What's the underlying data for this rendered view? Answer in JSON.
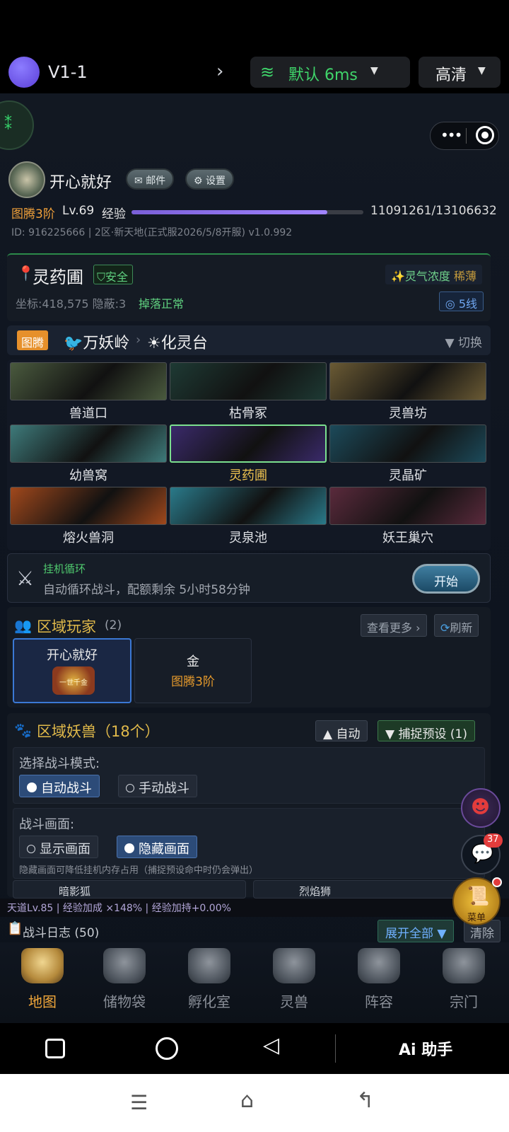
{
  "topbar": {
    "app_title": "V1-1",
    "network_label": "默认 6ms",
    "quality_label": "高清"
  },
  "profile": {
    "name": "开心就好",
    "mail_label": "邮件",
    "settings_label": "设置",
    "rank": "图腾3阶",
    "level": "Lv.69",
    "exp_label": "经验",
    "exp_value": "11091261/13106632",
    "exp_fraction": 0.846,
    "id_line": "ID: 916225666 | 2区·新天地(正式服2026/5/8开服) v1.0.992"
  },
  "location": {
    "name": "灵药圃",
    "safe_label": "安全",
    "aura_label": "灵气浓度",
    "aura_value": "稀薄",
    "coord": "坐标:418,575",
    "hidden": "隐蔽:3",
    "drop_status": "掉落正常",
    "line_label": "5线"
  },
  "region": {
    "tag": "图腾",
    "area": "万妖岭",
    "zone": "化灵台",
    "switch_label": "▼ 切换"
  },
  "maps": [
    {
      "name": "兽道口",
      "color": "#4a5a3e"
    },
    {
      "name": "枯骨冢",
      "color": "#1e3a34"
    },
    {
      "name": "灵兽坊",
      "color": "#6a5a34"
    },
    {
      "name": "幼兽窝",
      "color": "#3e7a7a"
    },
    {
      "name": "灵药圃",
      "color": "#3a2a6a",
      "selected": true
    },
    {
      "name": "灵晶矿",
      "color": "#1c4a5a"
    },
    {
      "name": "熔火兽洞",
      "color": "#a0481c"
    },
    {
      "name": "灵泉池",
      "color": "#2a7a8a"
    },
    {
      "name": "妖王巢穴",
      "color": "#5a2a3c"
    }
  ],
  "afk": {
    "title": "挂机循环",
    "desc": "自动循环战斗，配额剩余 5小时58分钟",
    "start_label": "开始"
  },
  "players": {
    "title": "区域玩家",
    "count": "(2)",
    "more_label": "查看更多 ›",
    "refresh_label": "刷新",
    "list": [
      {
        "name": "开心就好",
        "badge": "一世千金"
      },
      {
        "name": "金",
        "rank": "图腾3阶"
      }
    ]
  },
  "beasts": {
    "title": "区域妖兽（18个）",
    "auto_label": "▲ 自动",
    "preset_label": "▼ 捕捉预设 (1)",
    "battle_mode_title": "选择战斗模式:",
    "auto_battle": "自动战斗",
    "manual_battle": "手动战斗",
    "screen_title": "战斗画面:",
    "show_screen": "显示画面",
    "hide_screen": "隐藏画面",
    "hint": "隐藏画面可降低挂机内存占用（捕捉预设命中时仍会弹出）",
    "partial_1": "暗影狐",
    "partial_2": "烈焰狮"
  },
  "status_line": "天道Lv.85 | 经验加成 ×148% | 经验加持+0.00%",
  "log": {
    "label": "战斗日志 (50)",
    "expand_label": "展开全部 ▼",
    "clear_label": "清除"
  },
  "floaters": {
    "chat_badge": "37",
    "menu_label": "菜单"
  },
  "nav": [
    {
      "label": "地图",
      "active": true
    },
    {
      "label": "储物袋"
    },
    {
      "label": "孵化室"
    },
    {
      "label": "灵兽"
    },
    {
      "label": "阵容"
    },
    {
      "label": "宗门"
    }
  ],
  "android": {
    "ai_label": "Ai 助手"
  }
}
